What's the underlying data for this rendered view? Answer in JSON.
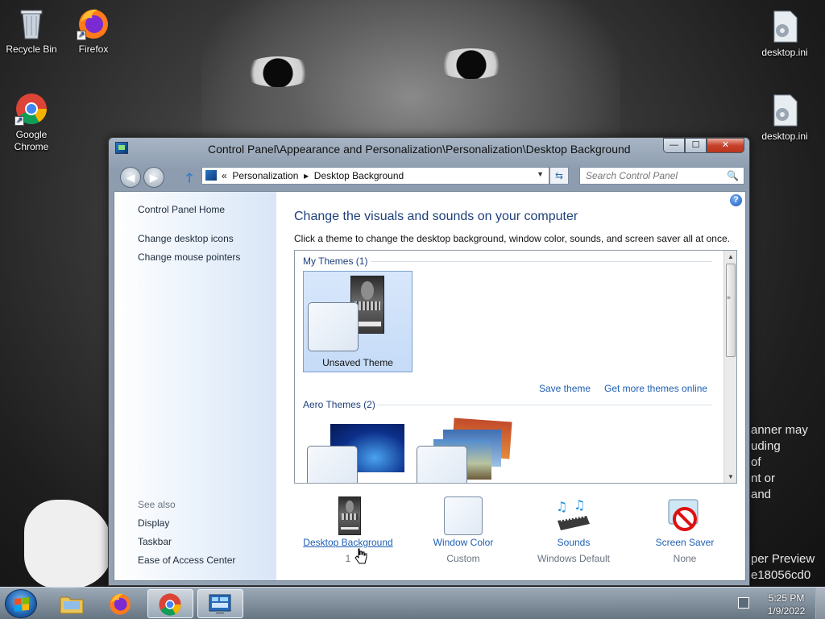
{
  "desktop": {
    "icons": [
      {
        "label": "Recycle Bin"
      },
      {
        "label": "Firefox"
      },
      {
        "label": "Google Chrome"
      },
      {
        "label": "desktop.ini"
      },
      {
        "label": "desktop.ini"
      }
    ],
    "wallpaper_text_lines": [
      "anner may",
      "uding",
      "of",
      "nt or",
      " and"
    ],
    "wallpaper_text_lines_2": [
      "per Preview",
      "e18056cd0"
    ]
  },
  "window": {
    "title": "Control Panel\\Appearance and Personalization\\Personalization\\Desktop Background",
    "controls": {
      "minimize": "—",
      "maximize": "☐",
      "close": "✕"
    },
    "address": {
      "prefix": "«",
      "crumb1": "Personalization",
      "sep": "▸",
      "crumb2": "Desktop Background"
    },
    "search": {
      "placeholder": "Search Control Panel"
    },
    "left_pane": {
      "home": "Control Panel Home",
      "links": [
        "Change desktop icons",
        "Change mouse pointers"
      ],
      "see_also_label": "See also",
      "see_also": [
        "Display",
        "Taskbar",
        "Ease of Access Center"
      ]
    },
    "main": {
      "heading": "Change the visuals and sounds on your computer",
      "subtext": "Click a theme to change the desktop background, window color, sounds, and screen saver all at once.",
      "my_themes": "My Themes (1)",
      "unsaved_theme": "Unsaved Theme",
      "save_theme": "Save theme",
      "get_more": "Get more themes online",
      "aero_themes": "Aero Themes (2)"
    },
    "bottom": [
      {
        "label": "Desktop Background",
        "sub": "1"
      },
      {
        "label": "Window Color",
        "sub": "Custom"
      },
      {
        "label": "Sounds",
        "sub": "Windows Default"
      },
      {
        "label": "Screen Saver",
        "sub": "None"
      }
    ]
  },
  "taskbar": {
    "time": "5:25 PM",
    "date": "1/9/2022"
  }
}
